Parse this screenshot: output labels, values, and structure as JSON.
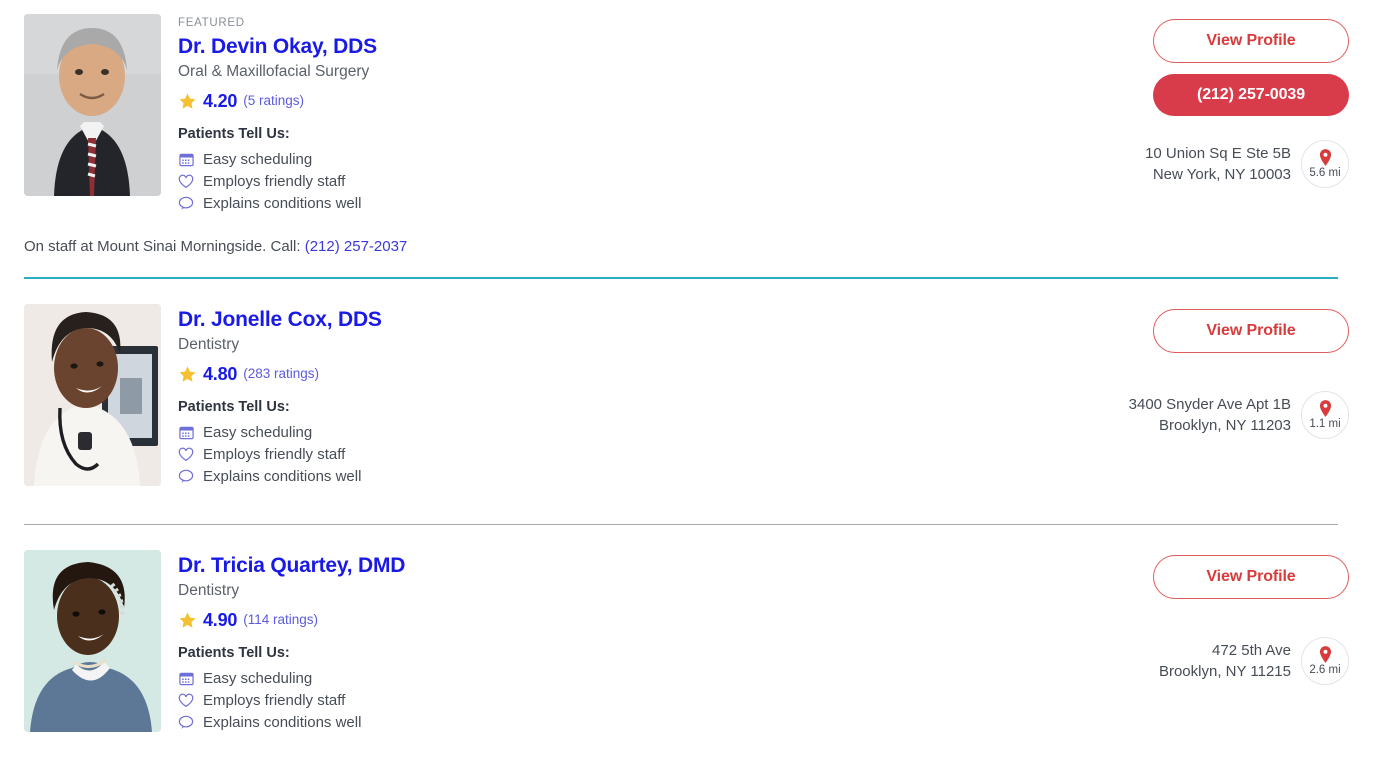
{
  "colors": {
    "name_blue": "#1a1ae6",
    "accent_red": "#d83b4a",
    "star_gold": "#f5c132",
    "divider_teal": "#2cadbd",
    "icon_purple": "#6f6fd8"
  },
  "patients_tell_us": {
    "title": "Patients Tell Us:",
    "items": [
      {
        "icon": "calendar-icon",
        "label": "Easy scheduling"
      },
      {
        "icon": "heart-icon",
        "label": "Employs friendly staff"
      },
      {
        "icon": "speech-bubble-icon",
        "label": "Explains conditions well"
      }
    ]
  },
  "cards": [
    {
      "featured_label": "FEATURED",
      "name": "Dr. Devin Okay, DDS",
      "specialty": "Oral & Maxillofacial Surgery",
      "rating": "4.20",
      "rating_count": "(5 ratings)",
      "view_profile_label": "View Profile",
      "phone_label": "(212) 257-0039",
      "address_line1": "10 Union Sq E Ste 5B",
      "address_line2": "New York, NY 10003",
      "distance": "5.6 mi",
      "hospital_text": "On staff at Mount Sinai Morningside. Call: ",
      "hospital_phone": "(212) 257-2037"
    },
    {
      "featured_label": "",
      "name": "Dr. Jonelle Cox, DDS",
      "specialty": "Dentistry",
      "rating": "4.80",
      "rating_count": "(283 ratings)",
      "view_profile_label": "View Profile",
      "phone_label": "",
      "address_line1": "3400 Snyder Ave Apt 1B",
      "address_line2": "Brooklyn, NY 11203",
      "distance": "1.1 mi",
      "hospital_text": "",
      "hospital_phone": ""
    },
    {
      "featured_label": "",
      "name": "Dr. Tricia Quartey, DMD",
      "specialty": "Dentistry",
      "rating": "4.90",
      "rating_count": "(114 ratings)",
      "view_profile_label": "View Profile",
      "phone_label": "",
      "address_line1": "472 5th Ave",
      "address_line2": "Brooklyn, NY 11215",
      "distance": "2.6 mi",
      "hospital_text": "",
      "hospital_phone": ""
    }
  ]
}
